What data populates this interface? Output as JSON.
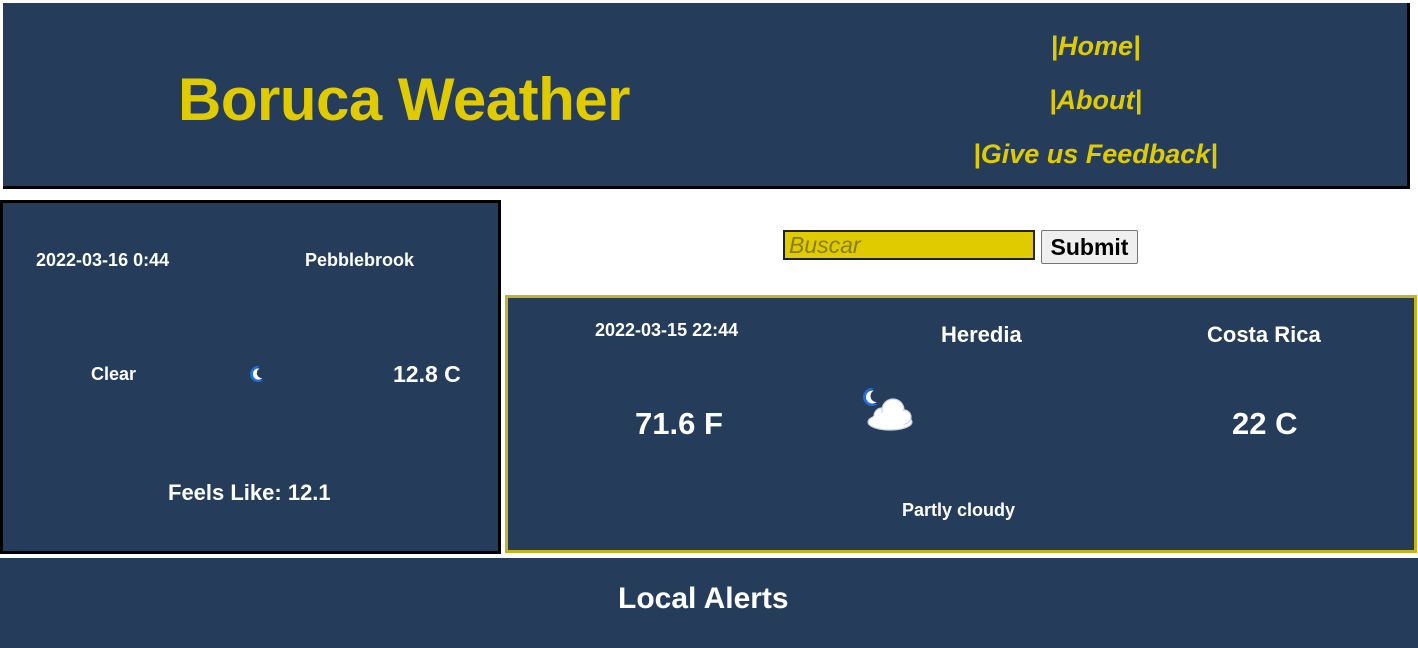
{
  "header": {
    "brand": "Boruca Weather",
    "nav": [
      "|Home|",
      "|About|",
      "|Give us Feedback|"
    ]
  },
  "local": {
    "datetime": "2022-03-16 0:44",
    "city": "Pebblebrook",
    "condition": "Clear",
    "condition_icon": "moon-icon",
    "temp_c": "12.8 C",
    "feels_like": "Feels Like: 12.1"
  },
  "search": {
    "placeholder": "Buscar",
    "submit_label": "Submit"
  },
  "result": {
    "datetime": "2022-03-15 22:44",
    "city": "Heredia",
    "country": "Costa Rica",
    "temp_f": "71.6 F",
    "temp_c": "22 C",
    "condition": "Partly cloudy",
    "condition_icon": "partly-cloudy-night-icon"
  },
  "alerts": {
    "title": "Local Alerts"
  },
  "colors": {
    "navy": "#253d5b",
    "accent_yellow": "#dfcb00",
    "text": "#ffffff"
  }
}
